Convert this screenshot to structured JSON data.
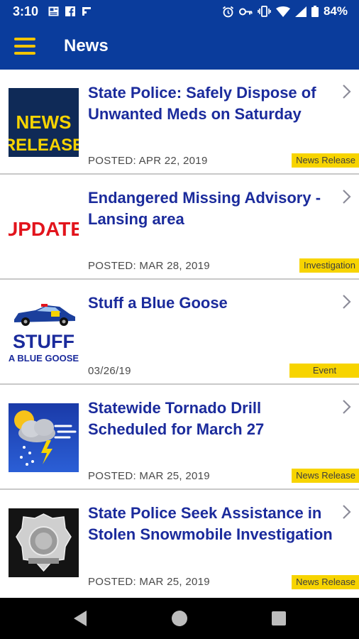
{
  "status_bar": {
    "time": "3:10",
    "battery_percent": "84%",
    "left_icons": [
      "newspaper-icon",
      "facebook-icon",
      "flipboard-icon"
    ],
    "right_icons": [
      "alarm-icon",
      "key-icon",
      "vibrate-icon",
      "wifi-icon",
      "signal-icon",
      "battery-icon"
    ]
  },
  "app_bar": {
    "title": "News",
    "menu_icon": "hamburger-menu-icon",
    "background_color": "#0a3c9c",
    "accent_color": "#f2c400"
  },
  "articles": [
    {
      "title": "State Police: Safely Dispose of Unwanted Meds on Saturday",
      "posted": "POSTED: APR 22, 2019",
      "category": "News Release",
      "thumbnail": {
        "type": "news-release",
        "line1": "NEWS",
        "line2": "RELEASE"
      }
    },
    {
      "title": "Endangered Missing Advisory - Lansing area",
      "posted": "POSTED: MAR 28, 2019",
      "category": "Investigation",
      "thumbnail": {
        "type": "update",
        "line1": "UPDATE"
      }
    },
    {
      "title": "Stuff a Blue Goose",
      "posted": "03/26/19",
      "category": "Event",
      "thumbnail": {
        "type": "blue-goose",
        "line1": "STUFF",
        "line2": "A BLUE GOOSE"
      }
    },
    {
      "title": "Statewide Tornado Drill Scheduled for March 27",
      "posted": "POSTED: MAR 25, 2019",
      "category": "News Release",
      "thumbnail": {
        "type": "weather"
      }
    },
    {
      "title": "State Police Seek Assistance in Stolen Snowmobile Investigation",
      "posted": "POSTED: MAR 25, 2019",
      "category": "News Release",
      "thumbnail": {
        "type": "badge"
      }
    }
  ],
  "colors": {
    "title_text": "#1b2b9c",
    "badge_background": "#f7d400",
    "divider": "#c9c9c9"
  },
  "nav_bar": {
    "buttons": [
      "back-icon",
      "home-icon",
      "recents-icon"
    ]
  }
}
